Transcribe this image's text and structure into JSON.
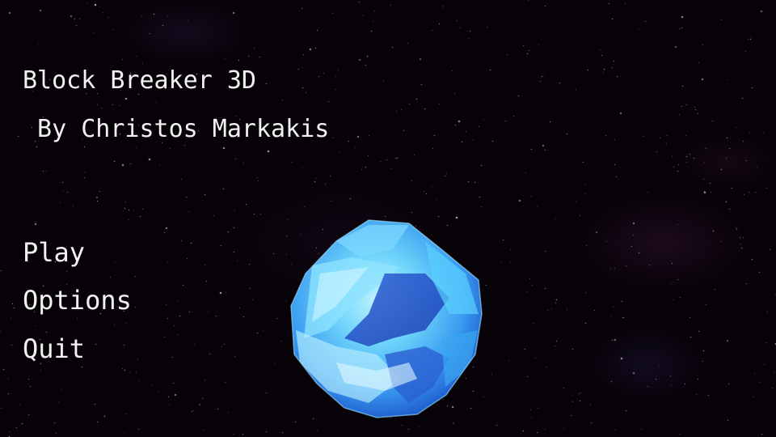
{
  "game": {
    "title": "Block Breaker 3D",
    "credit": " By Christos Markakis"
  },
  "menu": {
    "items": [
      {
        "label": "Play"
      },
      {
        "label": "Options"
      },
      {
        "label": "Quit"
      }
    ]
  },
  "colors": {
    "background": "#060207",
    "text": "#f2f2f2",
    "ball_light": "#8fe8ff",
    "ball_mid": "#3a9cf0",
    "ball_dark": "#1a4fc8"
  },
  "icons": {
    "ball": "crystal-sphere-icon"
  }
}
